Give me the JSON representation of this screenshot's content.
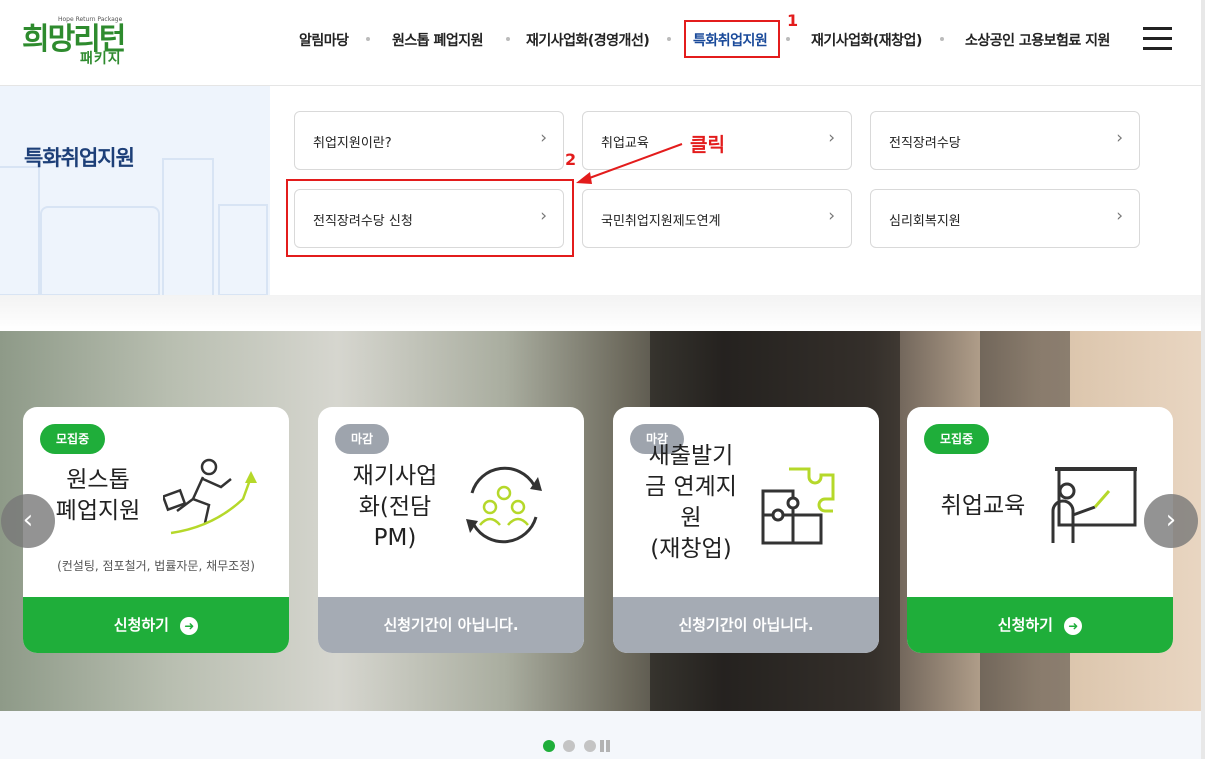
{
  "logo": {
    "main": "희망리턴",
    "sub": "Hope Return Package",
    "pkg": "패키지"
  },
  "nav": {
    "items": [
      {
        "label": "알림마당"
      },
      {
        "label": "원스톱 폐업지원"
      },
      {
        "label": "재기사업화(경영개선)"
      },
      {
        "label": "특화취업지원"
      },
      {
        "label": "재기사업화(재창업)"
      },
      {
        "label": "소상공인 고용보험료 지원"
      }
    ]
  },
  "annotations": {
    "step1": "1",
    "step2": "2",
    "click": "클릭"
  },
  "submenu": {
    "title": "특화취업지원",
    "items": [
      {
        "label": "취업지원이란?"
      },
      {
        "label": "취업교육"
      },
      {
        "label": "전직장려수당"
      },
      {
        "label": "전직장려수당 신청"
      },
      {
        "label": "국민취업지원제도연계"
      },
      {
        "label": "심리회복지원"
      }
    ],
    "chevron": "›"
  },
  "cards": [
    {
      "badge": "모집중",
      "title": "원스톱\n폐업지원",
      "desc": "(컨설팅, 점포철거, 법률자문, 채무조정)",
      "button": "신청하기",
      "status": "open",
      "icon": "running-man-icon"
    },
    {
      "badge": "마감",
      "title": "재기사업\n화(전담\nPM)",
      "desc": "",
      "button": "신청기간이 아닙니다.",
      "status": "closed",
      "icon": "team-cycle-icon"
    },
    {
      "badge": "마감",
      "title": "새출발기\n금 연계지\n원\n(재창업)",
      "desc": "",
      "button": "신청기간이 아닙니다.",
      "status": "closed",
      "icon": "puzzle-icon"
    },
    {
      "badge": "모집중",
      "title": "취업교육",
      "desc": "",
      "button": "신청하기",
      "status": "open",
      "icon": "teacher-board-icon"
    }
  ],
  "carousel": {
    "prev": "‹",
    "next": "›"
  },
  "colors": {
    "green": "#1fae3a",
    "navy": "#1d3f78",
    "annotation": "#e31c1c",
    "gray": "#a5abb4"
  }
}
